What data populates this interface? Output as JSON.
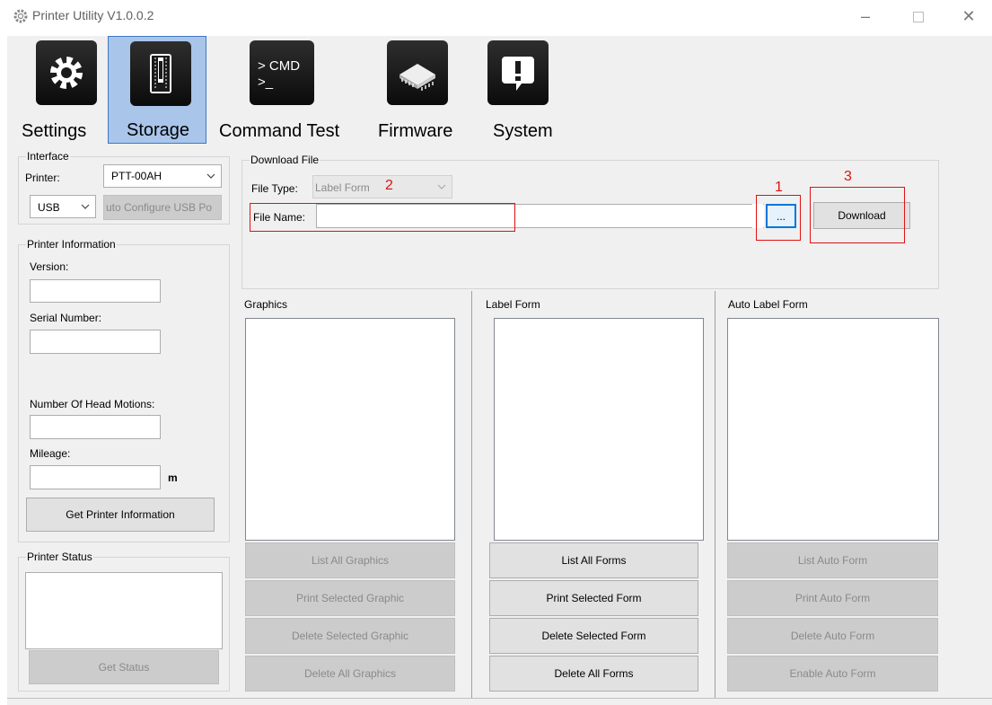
{
  "window": {
    "title": "Printer Utility  V1.0.0.2"
  },
  "toolbar": {
    "items": [
      {
        "label": "Settings",
        "icon": "gear-icon"
      },
      {
        "label": "Storage",
        "icon": "storage-card-icon"
      },
      {
        "label": "Command Test",
        "icon": "cmd-icon",
        "icon_text_1": "> CMD",
        "icon_text_2": ">_"
      },
      {
        "label": "Firmware",
        "icon": "chip-icon"
      },
      {
        "label": "System",
        "icon": "exclamation-icon"
      }
    ]
  },
  "interface": {
    "legend": "Interface",
    "printer_label": "Printer:",
    "printer_value": "PTT-00AH",
    "port_value": "USB",
    "auto_config_button": "uto Configure USB Po"
  },
  "printer_info": {
    "legend": "Printer Information",
    "version_label": "Version:",
    "version_value": "",
    "serial_label": "Serial Number:",
    "serial_value": "",
    "head_motions_label": "Number Of Head Motions:",
    "head_motions_value": "",
    "mileage_label": "Mileage:",
    "mileage_value": "",
    "mileage_unit": "m",
    "get_info_button": "Get Printer Information"
  },
  "printer_status": {
    "legend": "Printer Status",
    "status_text": "",
    "get_status_button": "Get Status"
  },
  "download": {
    "legend": "Download File",
    "file_type_label": "File Type:",
    "file_type_value": "Label Form",
    "file_name_label": "File Name:",
    "file_name_value": "",
    "browse_button": "...",
    "download_button": "Download"
  },
  "annotations": {
    "a1": "1",
    "a2": "2",
    "a3": "3",
    "color": "#e11111"
  },
  "graphics": {
    "header": "Graphics",
    "buttons": [
      "List All Graphics",
      "Print Selected Graphic",
      "Delete Selected Graphic",
      "Delete All Graphics"
    ]
  },
  "label_form": {
    "header": "Label Form",
    "buttons": [
      "List All Forms",
      "Print Selected Form",
      "Delete Selected Form",
      "Delete All Forms"
    ]
  },
  "auto_label_form": {
    "header": "Auto Label Form",
    "buttons": [
      "List Auto Form",
      "Print Auto Form",
      "Delete Auto Form",
      "Enable Auto Form"
    ]
  }
}
